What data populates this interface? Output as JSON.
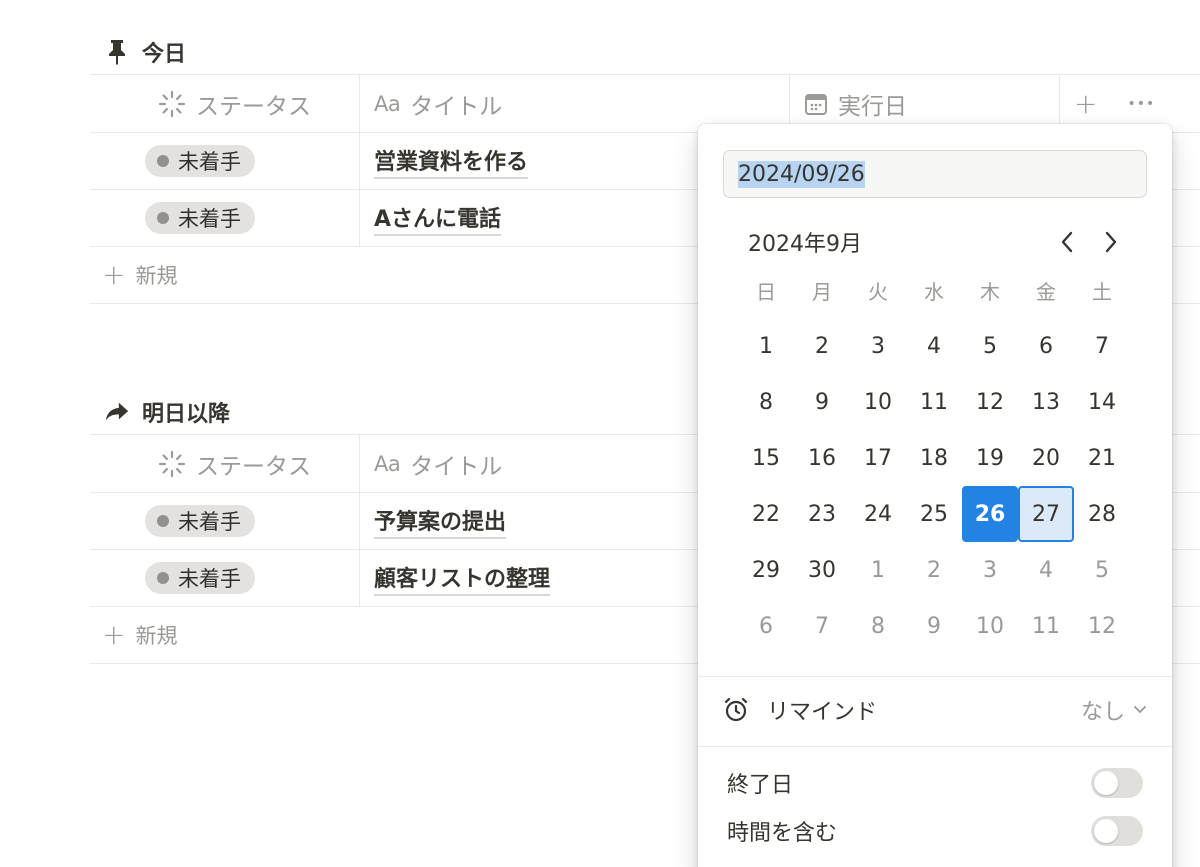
{
  "sections": [
    {
      "heading": "今日",
      "icon": "pin-icon",
      "columns": {
        "status": "ステータス",
        "title_prefix": "Aa",
        "title": "タイトル",
        "date": "実行日",
        "add": "+",
        "more": "•••"
      },
      "rows": [
        {
          "status": "未着手",
          "title": "営業資料を作る"
        },
        {
          "status": "未着手",
          "title": "Aさんに電話"
        }
      ],
      "new_label": "新規"
    },
    {
      "heading": "明日以降",
      "icon": "forward-arrow-icon",
      "columns": {
        "status": "ステータス",
        "title_prefix": "Aa",
        "title": "タイトル"
      },
      "rows": [
        {
          "status": "未着手",
          "title": "予算案の提出"
        },
        {
          "status": "未着手",
          "title": "顧客リストの整理"
        }
      ],
      "new_label": "新規"
    }
  ],
  "date_picker": {
    "input_value": "2024/09/26",
    "month_label": "2024年9月",
    "weekdays": [
      "日",
      "月",
      "火",
      "水",
      "木",
      "金",
      "土"
    ],
    "weeks": [
      [
        "1",
        "2",
        "3",
        "4",
        "5",
        "6",
        "7"
      ],
      [
        "8",
        "9",
        "10",
        "11",
        "12",
        "13",
        "14"
      ],
      [
        "15",
        "16",
        "17",
        "18",
        "19",
        "20",
        "21"
      ],
      [
        "22",
        "23",
        "24",
        "25",
        "26",
        "27",
        "28"
      ],
      [
        "29",
        "30",
        "1",
        "2",
        "3",
        "4",
        "5"
      ],
      [
        "6",
        "7",
        "8",
        "9",
        "10",
        "11",
        "12"
      ]
    ],
    "selected_day": "26",
    "hovered_day": "27",
    "remind_label": "リマインド",
    "remind_value": "なし",
    "end_date_label": "終了日",
    "include_time_label": "時間を含む",
    "end_date_enabled": false,
    "include_time_enabled": false,
    "accent_color": "#2383e2"
  }
}
